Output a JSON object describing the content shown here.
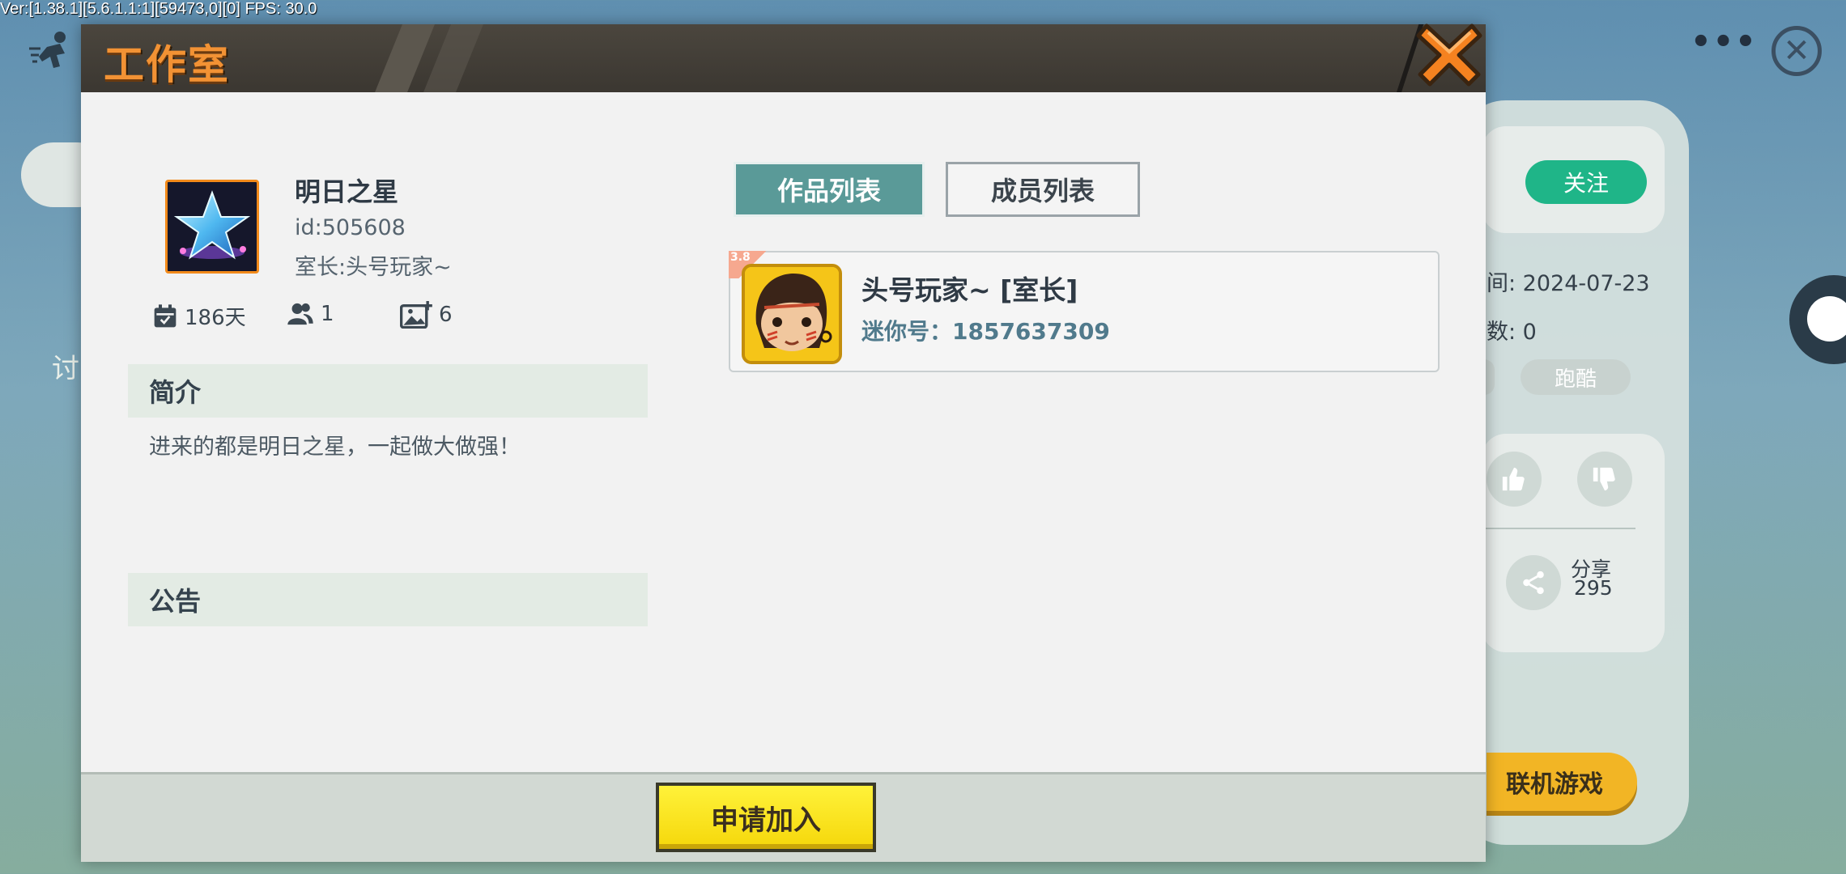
{
  "debug": {
    "text": "Ver:[1.38.1][5.6.1.1:1][59473,0][0] FPS: 30.0"
  },
  "background": {
    "follow_label": "关注",
    "date_label": "间: 2024-07-23",
    "count_label": "数: 0",
    "tag_label": "跑酷",
    "share_label": "分享",
    "share_count": "295",
    "multiplayer_label": "联机游戏",
    "left_char": "讨"
  },
  "modal": {
    "title": "工作室",
    "studio": {
      "name": "明日之星",
      "id_text": "id:505608",
      "owner_text": "室长:头号玩家~",
      "days": "186天",
      "members": "1",
      "works": "6"
    },
    "intro": {
      "heading": "简介",
      "text": "进来的都是明日之星，一起做大做强！"
    },
    "notice": {
      "heading": "公告"
    },
    "tabs": [
      {
        "label": "作品列表",
        "active": true
      },
      {
        "label": "成员列表",
        "active": false
      }
    ],
    "members": [
      {
        "name": "头号玩家~ [室长]",
        "mini_id": "迷你号：1857637309",
        "corner_badge": "3.8"
      }
    ],
    "join_label": "申请加入"
  },
  "colors": {
    "accent_orange": "#f29234",
    "tab_active": "#5a9a98",
    "follow_green": "#1fb588",
    "join_yellow": "#f5d70a"
  }
}
